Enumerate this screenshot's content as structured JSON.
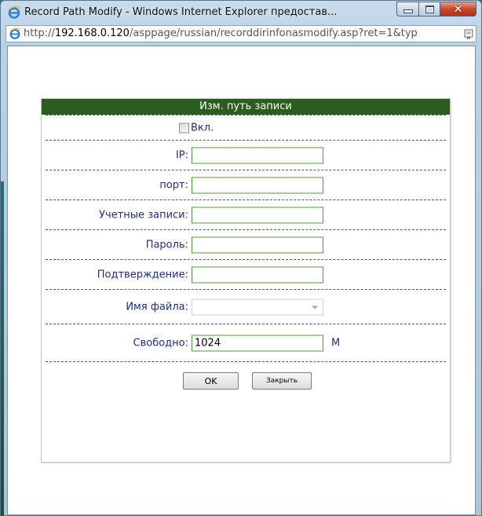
{
  "window": {
    "title": "Record Path Modify - Windows Internet Explorer предостав...",
    "icon": "ie-icon",
    "buttons": [
      "minimize-icon",
      "maximize-icon",
      "close-icon"
    ]
  },
  "address_bar": {
    "prefix": "http://",
    "host": "192.168.0.120",
    "path": "/asppage/russian/recorddirinfonasmodify.asp?ret=1&typ"
  },
  "form": {
    "header": "Изм. путь записи",
    "enable_label": "Вкл.",
    "fields": {
      "ip_label": "IP:",
      "ip_value": "",
      "port_label": "порт:",
      "port_value": "",
      "accounts_label": "Учетные записи:",
      "accounts_value": "",
      "password_label": "Пароль:",
      "password_value": "",
      "confirm_label": "Подтверждение:",
      "confirm_value": "",
      "filename_label": "Имя файла:",
      "filename_value": "",
      "free_label": "Свободно:",
      "free_value": "1024",
      "free_unit": "M"
    },
    "ok_label": "OK",
    "close_label": "Закрыть"
  },
  "colors": {
    "header_bg": "#2b5e1e",
    "label_color": "#1e2d8c",
    "input_border": "#4f9a3c"
  }
}
